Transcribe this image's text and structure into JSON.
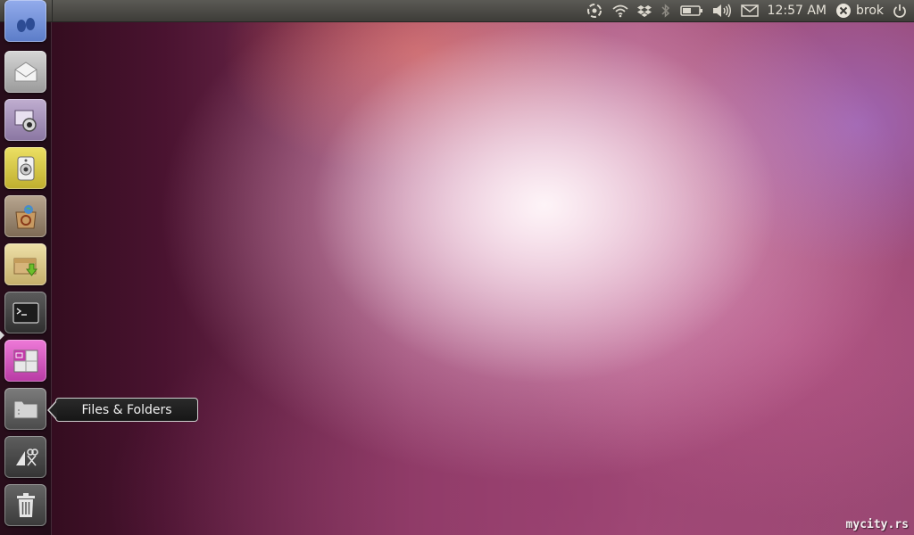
{
  "panel": {
    "clock": "12:57 AM",
    "username": "brok",
    "indicators": [
      "ubuntu-one-icon",
      "wifi-icon",
      "dropbox-icon",
      "bluetooth-icon",
      "battery-icon",
      "volume-icon",
      "mail-icon",
      "session-user-icon",
      "power-icon"
    ]
  },
  "launcher": {
    "items": [
      {
        "name": "launcher-item-empathy",
        "icon": "chat-feet-icon",
        "color": "#6f8fd8"
      },
      {
        "name": "launcher-item-mail",
        "icon": "envelope-icon",
        "color": "#bdbdbd"
      },
      {
        "name": "launcher-item-cheese",
        "icon": "webcam-icon",
        "color": "#a48fb8"
      },
      {
        "name": "launcher-item-music",
        "icon": "speaker-icon",
        "color": "#d9c94a"
      },
      {
        "name": "launcher-item-software-center",
        "icon": "shopping-bag-icon",
        "color": "#8a7a68"
      },
      {
        "name": "launcher-item-installer",
        "icon": "package-download-icon",
        "color": "#d9c98a"
      },
      {
        "name": "launcher-item-terminal",
        "icon": "terminal-icon",
        "color": "#4a4a4a"
      },
      {
        "name": "launcher-item-workspaces",
        "icon": "workspace-switcher-icon",
        "color": "#d85ac4"
      },
      {
        "name": "launcher-item-files",
        "icon": "folder-icon",
        "color": "#6a6a6a"
      },
      {
        "name": "launcher-item-applications",
        "icon": "applications-icon",
        "color": "#4e4e4e"
      },
      {
        "name": "launcher-item-trash",
        "icon": "trash-icon",
        "color": "#555555"
      }
    ]
  },
  "tooltip": {
    "text": "Files & Folders"
  },
  "watermark": {
    "text": "mycity.rs"
  }
}
